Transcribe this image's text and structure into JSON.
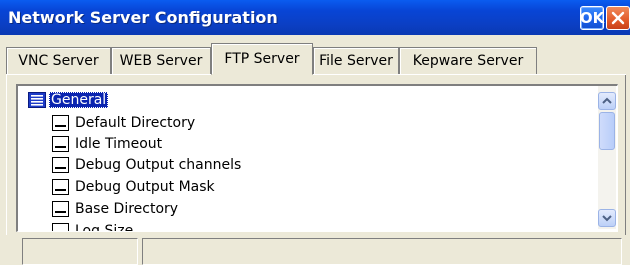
{
  "window": {
    "title": "Network Server Configuration",
    "ok_label": "OK"
  },
  "tabs": [
    {
      "label": "VNC Server"
    },
    {
      "label": "WEB Server"
    },
    {
      "label": "FTP Server",
      "active": true
    },
    {
      "label": "File Server"
    },
    {
      "label": "Kepware Server"
    }
  ],
  "tree": {
    "root_label": "General",
    "items": [
      {
        "label": "Default Directory"
      },
      {
        "label": "Idle Timeout"
      },
      {
        "label": "Debug Output channels"
      },
      {
        "label": "Debug Output Mask"
      },
      {
        "label": "Base Directory"
      },
      {
        "label": "Log Size"
      }
    ]
  },
  "status": {
    "pane1": "",
    "pane2": ""
  },
  "colors": {
    "title_bar": "#0a47d6",
    "selection": "#0a24b0",
    "close_button": "#e25a2a"
  },
  "icons": [
    "document-list-icon",
    "leaf-node-icon",
    "close-icon",
    "chevron-up-icon",
    "chevron-down-icon"
  ]
}
